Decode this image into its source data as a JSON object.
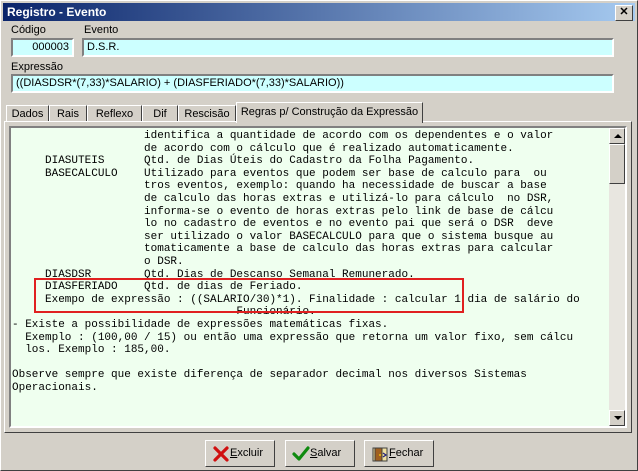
{
  "window": {
    "title": "Registro - Evento",
    "close_label": "✕"
  },
  "codigo": {
    "label": "Código",
    "value": "000003"
  },
  "evento": {
    "label": "Evento",
    "value": "D.S.R."
  },
  "expressao": {
    "label": "Expressão",
    "value": "((DIASDSR*(7,33)*SALARIO) + (DIASFERIADO*(7,33)*SALARIO))"
  },
  "tabs": [
    {
      "label": "Dados"
    },
    {
      "label": "Rais"
    },
    {
      "label": "Reflexo"
    },
    {
      "label": "Dif"
    },
    {
      "label": "Rescisão"
    },
    {
      "label": "Regras p/ Construção da Expressão"
    }
  ],
  "help_text": "                    identifica a quantidade de acordo com os dependentes e o valor\n                    de acordo com o cálculo que é realizado automaticamente.\n     DIASUTEIS      Qtd. de Dias Úteis do Cadastro da Folha Pagamento.\n     BASECALCULO    Utilizado para eventos que podem ser base de calculo para  ou\n                    tros eventos, exemplo: quando ha necessidade de buscar a base\n                    de calculo das horas extras e utilizá-lo para cálculo  no DSR,\n                    informa-se o evento de horas extras pelo link de base de cálcu\n                    lo no cadastro de eventos e no evento pai que será o DSR  deve\n                    ser utilizado o valor BASECALCULO para que o sistema busque au\n                    tomaticamente a base de calculo das horas extras para calcular\n                    o DSR.\n     DIASDSR        Qtd. Dias de Descanso Semanal Remunerado.\n     DIASFERIADO    Qtd. de dias de Feriado.\n     Exempo de expressão : ((SALARIO/30)*1). Finalidade : calcular 1 dia de salário do\n                                  Funcionário.\n- Existe a possibilidade de expressões matemáticas fixas.\n  Exemplo : (100,00 / 15) ou então uma expressão que retorna um valor fixo, sem cálcu\n  los. Exemplo : 185,00.\n\nObserve sempre que existe diferença de separador decimal nos diversos Sistemas\nOperacionais.",
  "buttons": {
    "excluir": "Excluir",
    "salvar": "Salvar",
    "fechar": "Fechar"
  },
  "icons": {
    "excluir": "red-x-icon",
    "salvar": "green-check-icon",
    "fechar": "door-exit-icon"
  },
  "colors": {
    "field_bg": "#ccffff",
    "memo_bg": "#efffef",
    "highlight": "#e02020",
    "titlebar_start": "#0a246a",
    "titlebar_end": "#a6caf0"
  }
}
